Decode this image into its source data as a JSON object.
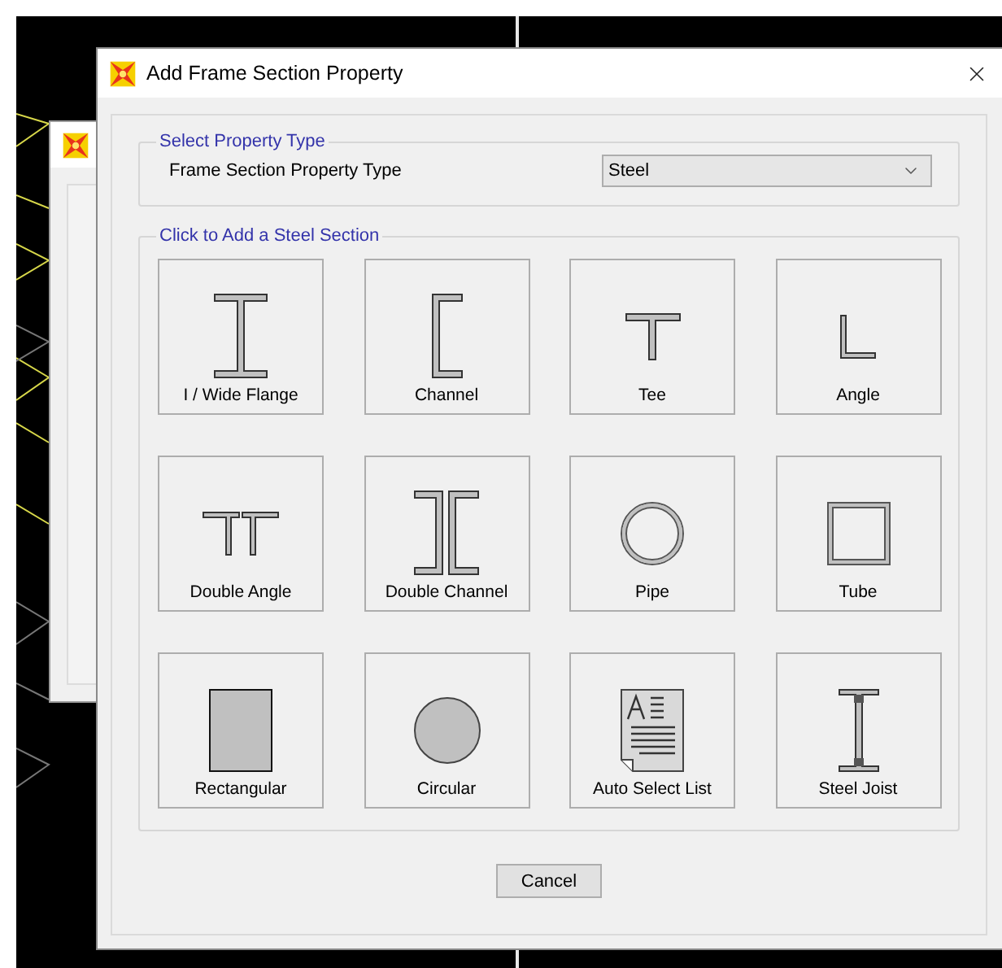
{
  "window": {
    "title": "Add Frame Section Property"
  },
  "property_type_group": {
    "title": "Select Property Type",
    "label": "Frame Section Property Type",
    "dropdown": {
      "value": "Steel"
    }
  },
  "section_group": {
    "title": "Click to Add a Steel Section",
    "sections": [
      {
        "label": "I / Wide Flange",
        "kind": "i"
      },
      {
        "label": "Channel",
        "kind": "channel"
      },
      {
        "label": "Tee",
        "kind": "tee"
      },
      {
        "label": "Angle",
        "kind": "angle"
      },
      {
        "label": "Double Angle",
        "kind": "double_angle"
      },
      {
        "label": "Double Channel",
        "kind": "double_channel"
      },
      {
        "label": "Pipe",
        "kind": "pipe"
      },
      {
        "label": "Tube",
        "kind": "tube"
      },
      {
        "label": "Rectangular",
        "kind": "rectangular"
      },
      {
        "label": "Circular",
        "kind": "circular"
      },
      {
        "label": "Auto Select List",
        "kind": "auto_list"
      },
      {
        "label": "Steel Joist",
        "kind": "joist"
      }
    ]
  },
  "buttons": [
    {
      "label": "Cancel"
    }
  ]
}
